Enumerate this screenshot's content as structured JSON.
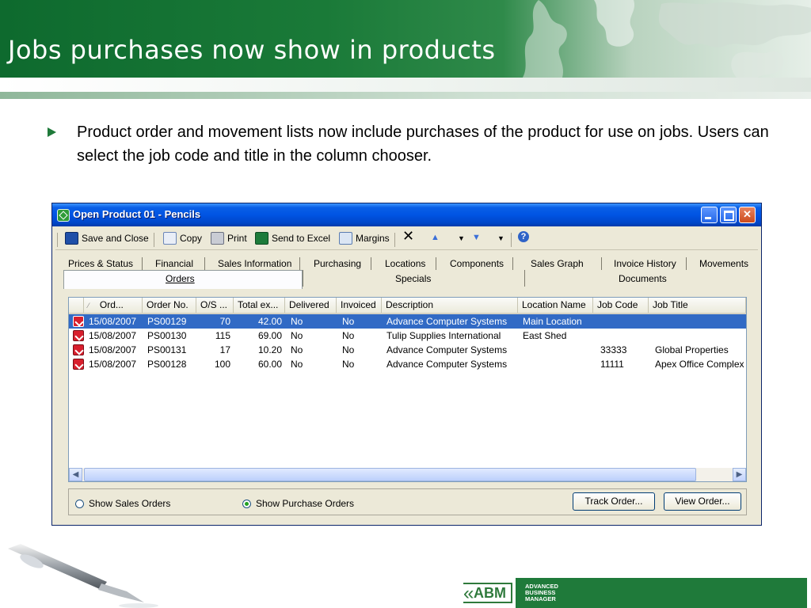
{
  "slide": {
    "title": "Jobs purchases now show in products",
    "bullet": "Product order and movement lists now include purchases of the product for use on jobs. Users can select the job code and title in the column chooser."
  },
  "window": {
    "title": "Open Product 01 - Pencils",
    "toolbar": {
      "save_close": "Save and Close",
      "copy": "Copy",
      "print": "Print",
      "send_excel": "Send to Excel",
      "margins": "Margins"
    },
    "tabs_row1": [
      "Prices & Status",
      "Financial",
      "Sales Information",
      "Purchasing",
      "Locations",
      "Components",
      "Sales Graph",
      "Invoice History",
      "Movements"
    ],
    "tabs_row2": [
      "Orders",
      "Specials",
      "Documents"
    ],
    "active_tab": "Orders",
    "columns": [
      "Ord...",
      "Order No.",
      "O/S ...",
      "Total ex...",
      "Delivered",
      "Invoiced",
      "Description",
      "Location Name",
      "Job Code",
      "Job Title"
    ],
    "rows": [
      {
        "date": "15/08/2007",
        "order_no": "PS00129",
        "os": "70",
        "total": "42.00",
        "delivered": "No",
        "invoiced": "No",
        "description": "Advance Computer Systems",
        "location": "Main Location",
        "job_code": "",
        "job_title": ""
      },
      {
        "date": "15/08/2007",
        "order_no": "PS00130",
        "os": "115",
        "total": "69.00",
        "delivered": "No",
        "invoiced": "No",
        "description": "Tulip Supplies International",
        "location": "East Shed",
        "job_code": "",
        "job_title": ""
      },
      {
        "date": "15/08/2007",
        "order_no": "PS00131",
        "os": "17",
        "total": "10.20",
        "delivered": "No",
        "invoiced": "No",
        "description": "Advance Computer Systems",
        "location": "",
        "job_code": "33333",
        "job_title": "Global Properties"
      },
      {
        "date": "15/08/2007",
        "order_no": "PS00128",
        "os": "100",
        "total": "60.00",
        "delivered": "No",
        "invoiced": "No",
        "description": "Advance Computer Systems",
        "location": "",
        "job_code": "11111",
        "job_title": "Apex Office Complex"
      }
    ],
    "footer": {
      "radio_sales": "Show Sales Orders",
      "radio_purchase": "Show Purchase Orders",
      "selected_radio": "Show Purchase Orders",
      "track_order": "Track Order...",
      "view_order": "View Order..."
    }
  },
  "logo": {
    "mark": "ABM",
    "line1": "ADVANCED",
    "line2": "BUSINESS",
    "line3": "MANAGER"
  },
  "colors": {
    "header_green": "#0e6a2e",
    "selection_blue": "#316ac5",
    "titlebar_blue": "#0054e3"
  }
}
